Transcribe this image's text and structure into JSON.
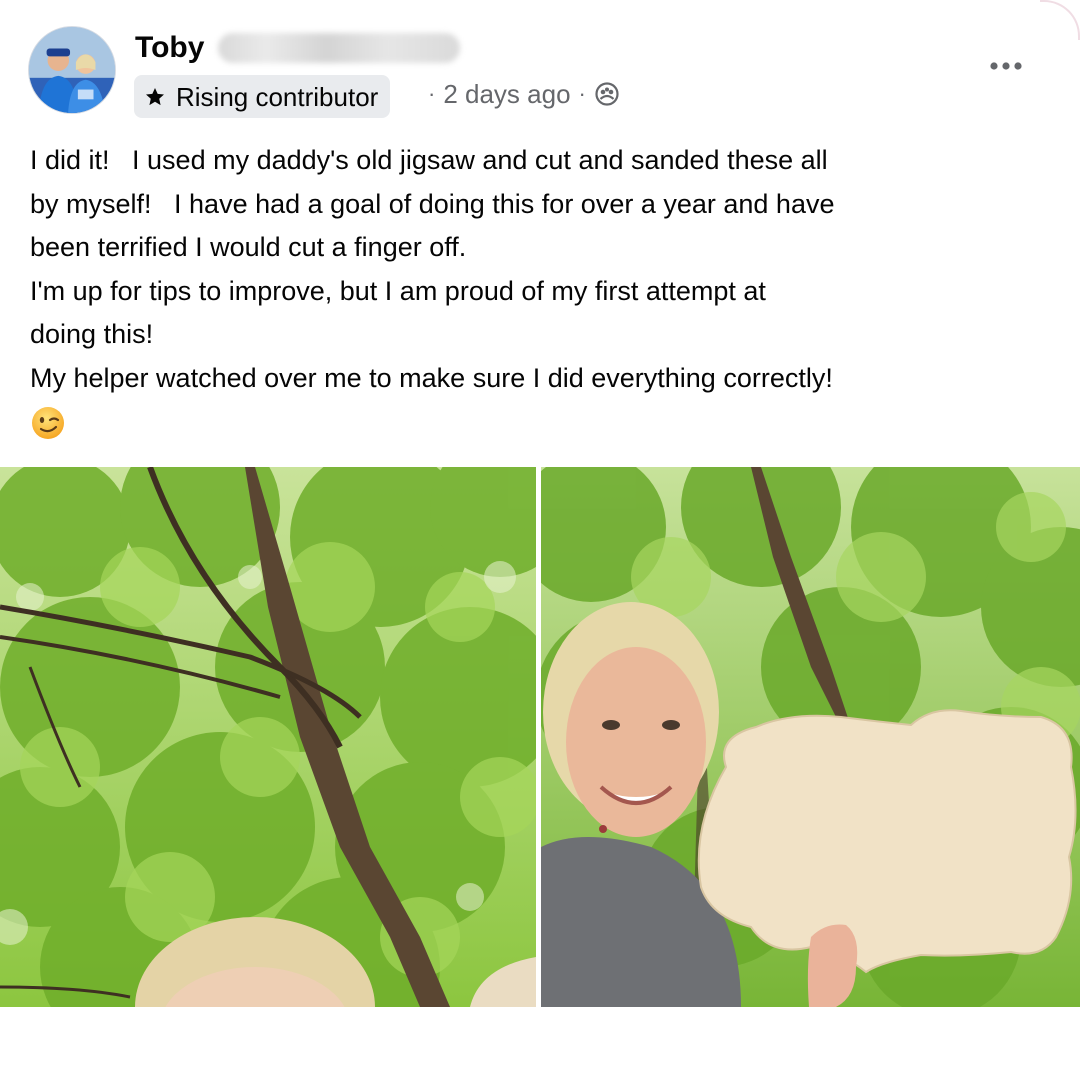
{
  "post": {
    "author": {
      "name": "Toby",
      "avatar_icon": "avatar-photo"
    },
    "badge": {
      "icon": "star-icon",
      "label": "Rising contributor"
    },
    "meta": {
      "separator": "·",
      "time": "2 days ago",
      "audience_icon": "group-audience-icon"
    },
    "more_icon": "more-options-icon",
    "text_lines": [
      "I did it!   I used my daddy's old jigsaw and cut and sanded these all",
      "by myself!   I have had a goal of doing this for over a year and have",
      "been terrified I would cut a finger off.",
      "I'm up for tips to improve, but I am proud of my first attempt at",
      "doing this!",
      "My helper watched over me to make sure I did everything correctly!"
    ],
    "text_emoji": "winking-face-emoji",
    "photos": [
      {
        "icon": "photo-trees-canopy"
      },
      {
        "icon": "photo-woman-holding-wood-cutout"
      }
    ]
  },
  "colors": {
    "text": "#050505",
    "secondary": "#65676b",
    "badge_bg": "#e9ebee",
    "leaf_green": "#7fbf2e"
  }
}
